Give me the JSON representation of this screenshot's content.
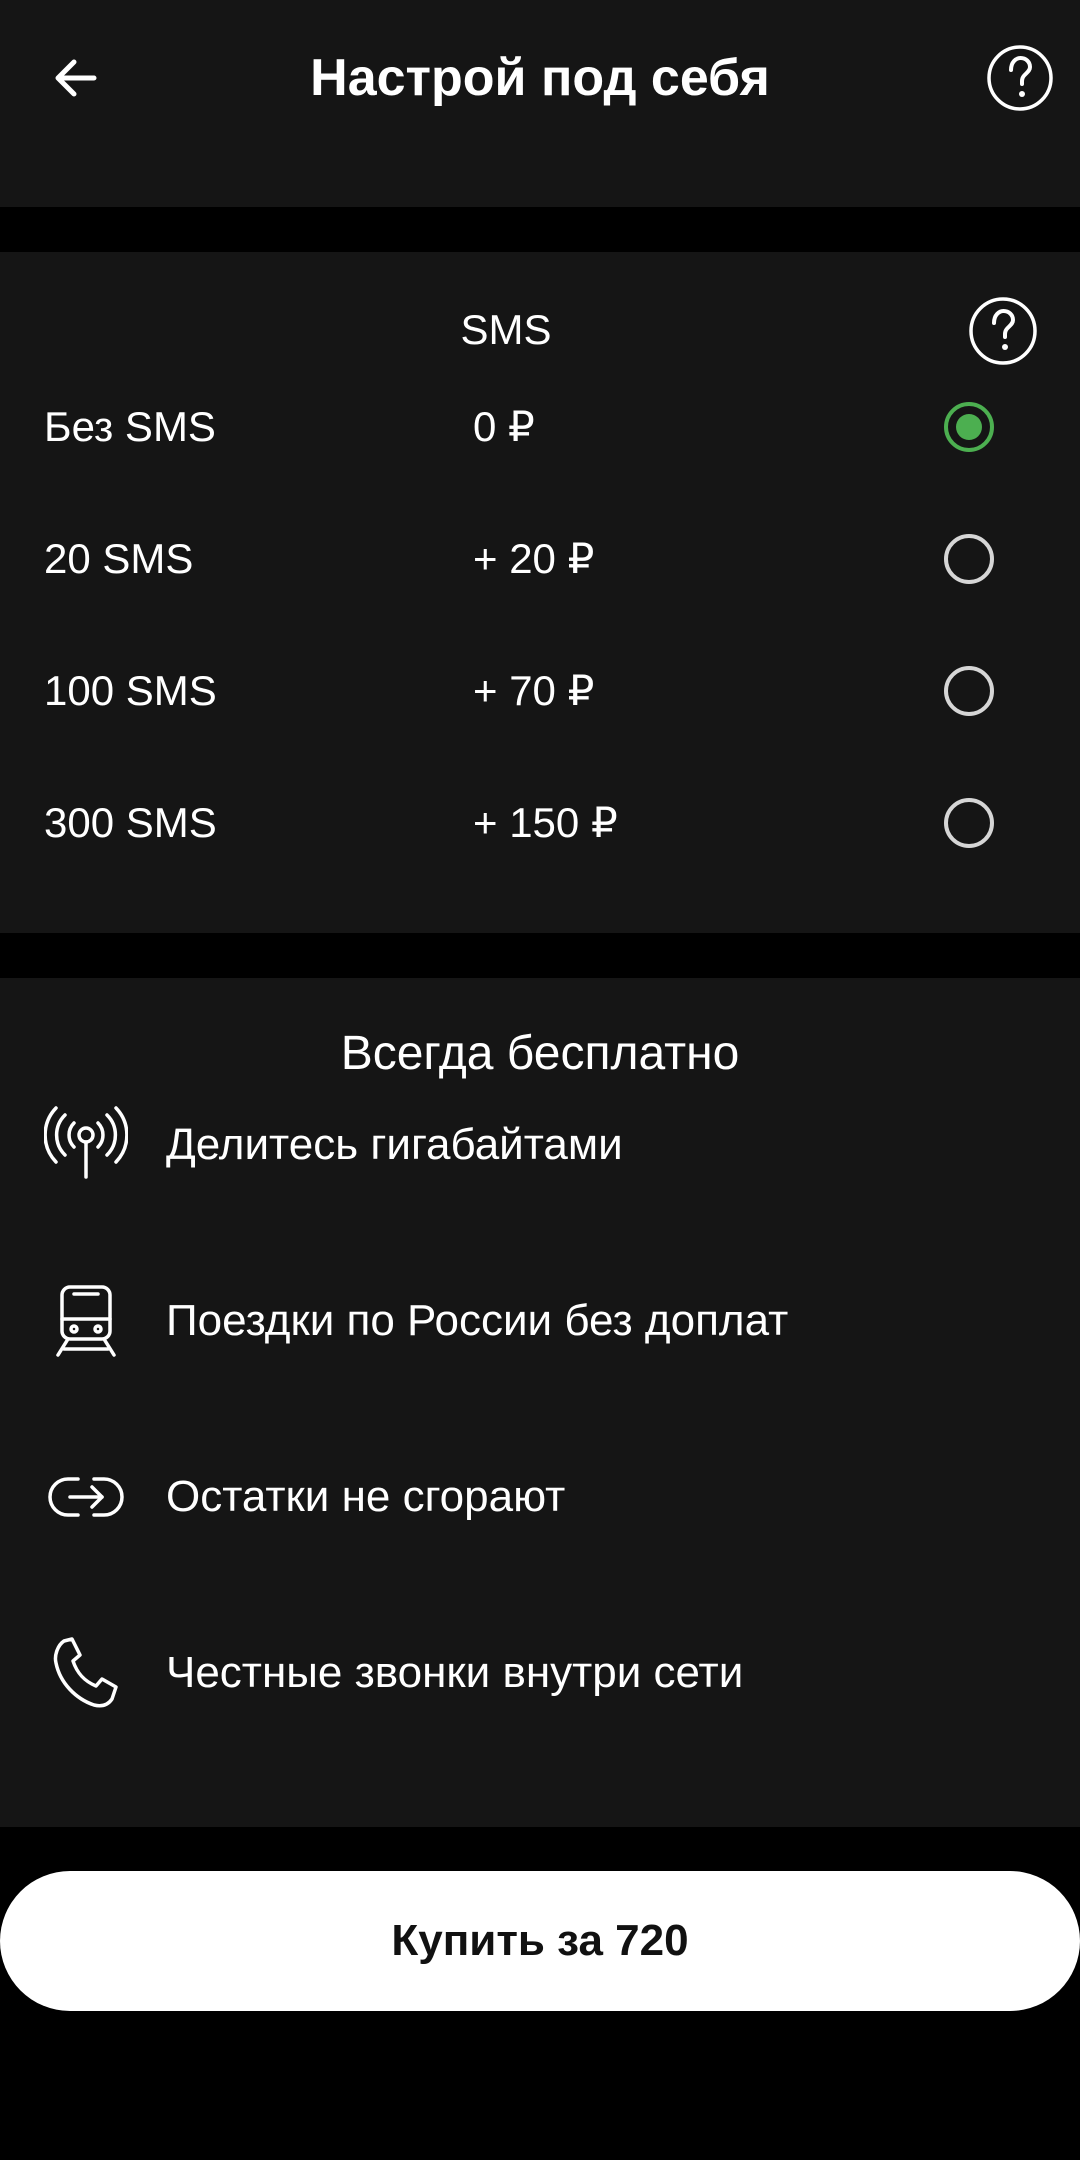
{
  "header": {
    "title": "Настрой под себя",
    "back_icon": "arrow-left-icon",
    "help_icon": "question-circle-icon"
  },
  "sms": {
    "title": "SMS",
    "help_icon": "question-circle-icon",
    "selected_index": 0,
    "options": [
      {
        "label": "Без SMS",
        "price": "0 ₽"
      },
      {
        "label": "20 SMS",
        "price": "+ 20 ₽"
      },
      {
        "label": "100 SMS",
        "price": "+ 70 ₽"
      },
      {
        "label": "300 SMS",
        "price": "+ 150 ₽"
      }
    ]
  },
  "free": {
    "title": "Всегда бесплатно",
    "features": [
      {
        "icon": "antenna-broadcast-icon",
        "label": "Делитесь гигабайтами"
      },
      {
        "icon": "train-icon",
        "label": "Поездки по России без доплат"
      },
      {
        "icon": "rollover-arrow-icon",
        "label": "Остатки не сгорают"
      },
      {
        "icon": "phone-icon",
        "label": "Честные звонки внутри сети"
      }
    ]
  },
  "buy_button": {
    "label": "Купить за 720"
  },
  "colors": {
    "background": "#000000",
    "surface": "#151515",
    "accent_green": "#4caf50",
    "radio_border": "#d6d6d6",
    "button_bg": "#ffffff"
  }
}
